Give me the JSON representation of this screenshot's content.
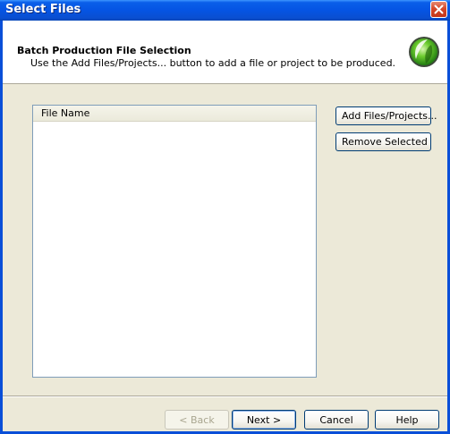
{
  "window": {
    "title": "Select Files"
  },
  "header": {
    "title": "Batch Production File Selection",
    "description": "Use the Add Files/Projects... button to add a file or project to be produced."
  },
  "file_list": {
    "column_header": "File Name",
    "rows": []
  },
  "side_buttons": {
    "add": "Add Files/Projects...",
    "remove": "Remove Selected"
  },
  "footer_buttons": {
    "back": "< Back",
    "next": "Next >",
    "cancel": "Cancel",
    "help": "Help"
  },
  "colors": {
    "titlebar": "#0554e3",
    "dialog_bg": "#ece9d8",
    "close": "#d6482a",
    "logo_green": "#3fb020"
  }
}
